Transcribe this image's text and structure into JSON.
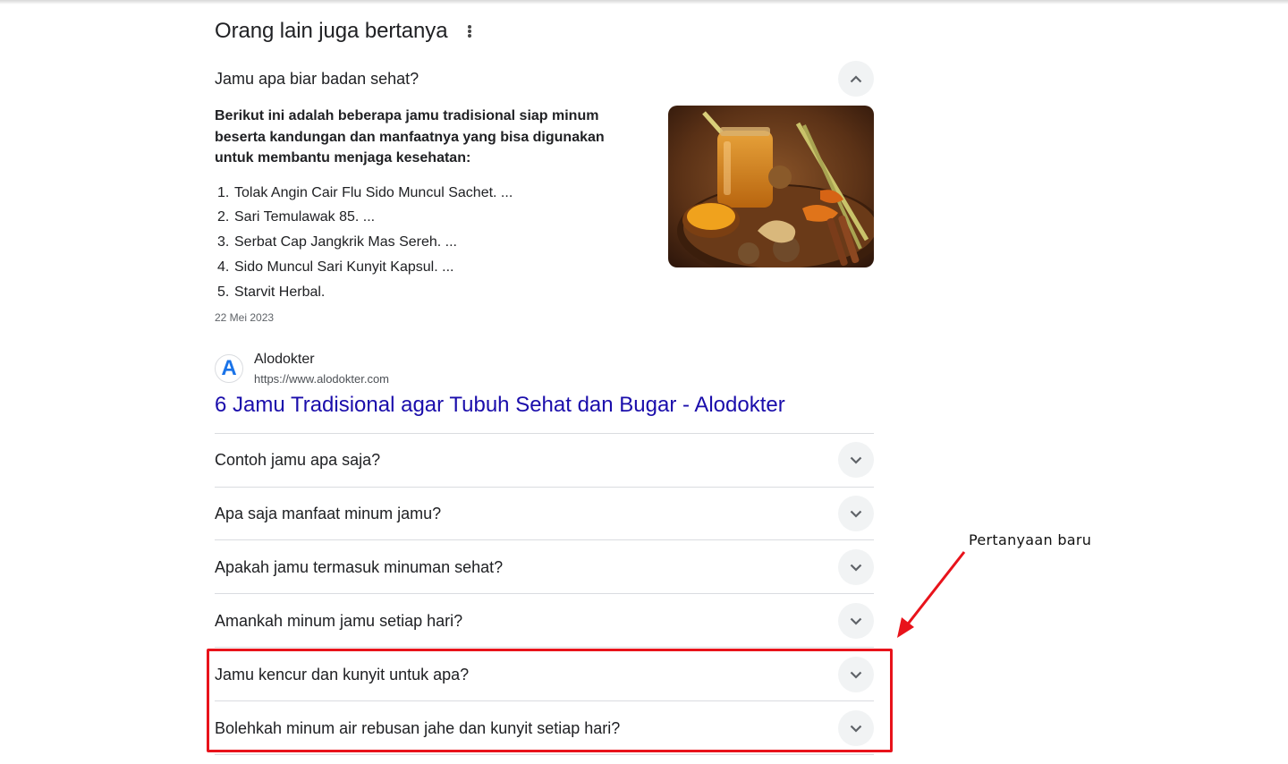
{
  "paa": {
    "title": "Orang lain juga bertanya",
    "more_options_icon": "kebab-vertical-icon",
    "expanded": {
      "question": "Jamu apa biar badan sehat?",
      "toggle_icon": "chevron-up-icon",
      "answer_lead": "Berikut ini adalah beberapa jamu tradisional siap minum beserta kandungan dan manfaatnya yang bisa digunakan untuk membantu menjaga kesehatan:",
      "list": [
        {
          "num": "1.",
          "text": "Tolak Angin Cair Flu Sido Muncul Sachet. ..."
        },
        {
          "num": "2.",
          "text": "Sari Temulawak 85. ..."
        },
        {
          "num": "3.",
          "text": "Serbat Cap Jangkrik Mas Sereh. ..."
        },
        {
          "num": "4.",
          "text": "Sido Muncul Sari Kunyit Kapsul. ..."
        },
        {
          "num": "5.",
          "text": "Starvit Herbal."
        }
      ],
      "date": "22 Mei 2023",
      "image_subject": "jamu-turmeric-ginger-photo",
      "source": {
        "favicon_letter": "A",
        "name": "Alodokter",
        "url": "https://www.alodokter.com",
        "link_title": "6 Jamu Tradisional agar Tubuh Sehat dan Bugar - Alodokter"
      }
    },
    "questions": [
      {
        "text": "Contoh jamu apa saja?",
        "toggle_icon": "chevron-down-icon"
      },
      {
        "text": "Apa saja manfaat minum jamu?",
        "toggle_icon": "chevron-down-icon"
      },
      {
        "text": "Apakah jamu termasuk minuman sehat?",
        "toggle_icon": "chevron-down-icon"
      },
      {
        "text": "Amankah minum jamu setiap hari?",
        "toggle_icon": "chevron-down-icon"
      },
      {
        "text": "Jamu kencur dan kunyit untuk apa?",
        "toggle_icon": "chevron-down-icon"
      },
      {
        "text": "Bolehkah minum air rebusan jahe dan kunyit setiap hari?",
        "toggle_icon": "chevron-down-icon"
      }
    ]
  },
  "annotation": {
    "label": "Pertanyaan baru",
    "color": "#e8131b"
  },
  "colors": {
    "link": "#1a0dab",
    "text": "#202124",
    "secondary_text": "#5f6368",
    "divider": "#dadce0",
    "chevron_bg": "#f1f3f4"
  }
}
